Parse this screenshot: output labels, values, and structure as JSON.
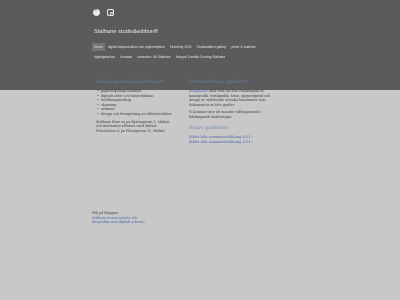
{
  "header": {
    "social": [
      "facebook-icon",
      "instagram-icon"
    ],
    "site_title": "Stalhane studio&edition®"
  },
  "nav": {
    "items": [
      "Home",
      "digital bildproduktion och pigmentprints",
      "Fineeting 2002",
      "Studioedition gallery",
      "priser & material",
      "digitalgraphics",
      "Asmaab",
      "konsertor: Ulf Stalhane",
      "fotograf Camilla Corning Stalhane"
    ]
  },
  "left": {
    "heading": "Stalhane studio&edition®",
    "services": [
      "pigmentprintproduktion",
      "digitalt arkiv och fotoreduktion",
      "bestllningsutskrig",
      "skanning",
      "utfrmne",
      "design och formgivning av affischer/aktier"
    ],
    "address_1": "Stalhane Hase ns pa Rystangsvan 5, Malmö",
    "address_2": "och mottasmot alltsmot vard Malmö",
    "address_3": "Fotostudion & pa Fleringsvan 21, Malmö"
  },
  "right": {
    "heading": "Studioedition gallery©",
    "intro_accent": "Webgallery",
    "intro": "med vera tas viva lomarkanda av konstgrafik, textilgrafik, foton, pigmentprint och design av etablerade svenska konstnärer som dokumentar av foto grafier",
    "info": "Vi kommer inte att mondra välfungerande i foltskapande kvalitetsgar",
    "news_heading": "Snart gallerier:",
    "link_1": "Bilder från sommarutställning 2021»",
    "link_2": "Bilder från sommarutställning 2021»"
  },
  "follow": {
    "label": "Följ på bloggen",
    "link_1": "Stalhane frozen snöelse och",
    "link_2": "fotografika med digitalt arbetet»"
  },
  "colors": {
    "header_bg": "#5b5b5b",
    "page_bg": "#c8c8c8",
    "accent": "#4a66aa",
    "heading": "#6680b2"
  }
}
